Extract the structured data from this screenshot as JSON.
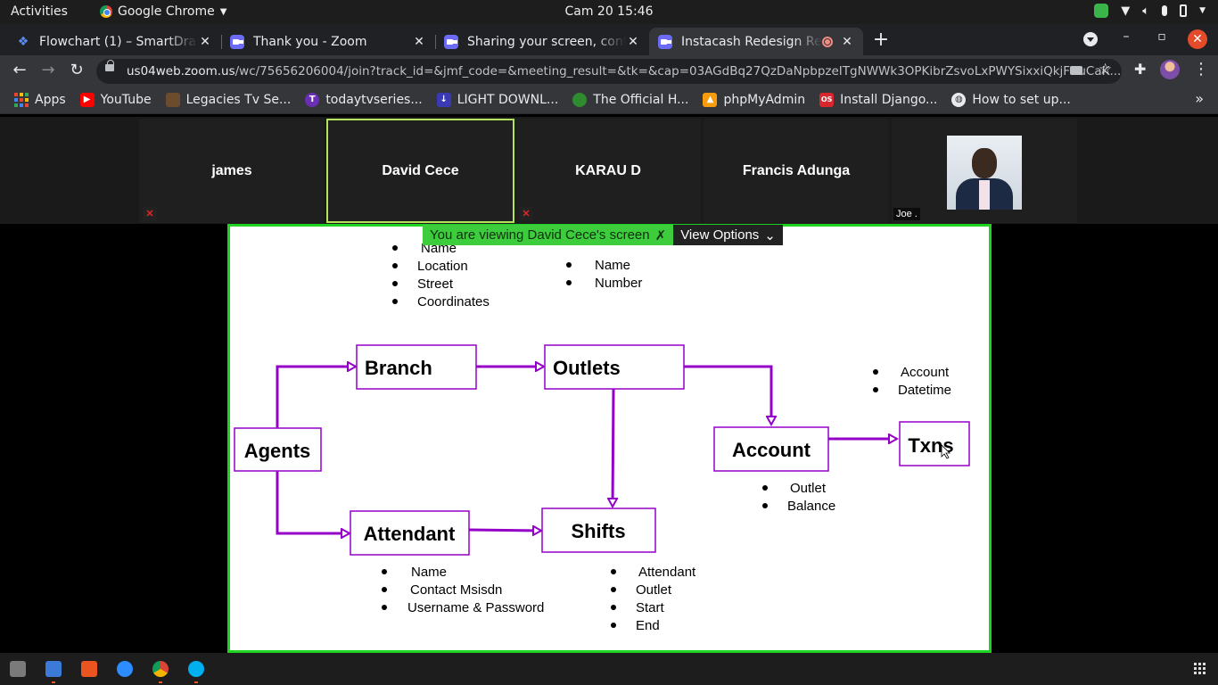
{
  "topbar": {
    "activities": "Activities",
    "app_name": "Google Chrome",
    "clock": "Cam 20  15:46"
  },
  "tabs": [
    {
      "title": "Flowchart (1) – SmartDraw",
      "favicon": "smartdraw-icon"
    },
    {
      "title": "Thank you - Zoom",
      "favicon": "zoom-icon"
    },
    {
      "title": "Sharing your screen, cont",
      "favicon": "zoom-icon"
    },
    {
      "title": "Instacash Redesign Re",
      "favicon": "zoom-icon",
      "recording": true
    }
  ],
  "omnibox": {
    "host": "us04web.zoom.us",
    "path": "/wc/75656206004/join?track_id=&jmf_code=&meeting_result=&tk=&cap=03AGdBq27QzDaNpbpzeITgNWWk3OPKibrZsvoLxPWYSixxiQkjFBuCaK..."
  },
  "bookmarks": [
    {
      "label": "Apps",
      "icon": "apps-grid-icon"
    },
    {
      "label": "YouTube",
      "icon": "youtube-icon",
      "color": "#ff0000"
    },
    {
      "label": "Legacies Tv Se...",
      "icon": "legacies-icon",
      "color": "#6b4c2f"
    },
    {
      "label": "todaytvseries...",
      "icon": "todaytv-icon",
      "color": "#6a2fb4"
    },
    {
      "label": "LIGHT DOWNL...",
      "icon": "download-icon",
      "color": "#3a3ab5"
    },
    {
      "label": "The Official H...",
      "icon": "official-icon",
      "color": "#2e8b2e"
    },
    {
      "label": "phpMyAdmin",
      "icon": "phpmyadmin-icon",
      "color": "#f89c0e"
    },
    {
      "label": "Install Django...",
      "icon": "os-icon",
      "color": "#d9262c"
    },
    {
      "label": "How to set up...",
      "icon": "globe-icon",
      "color": "#e8eaed"
    }
  ],
  "participants": [
    {
      "name": "james",
      "muted": true
    },
    {
      "name": "David Cece",
      "speaking": true,
      "muted": false
    },
    {
      "name": "KARAU D",
      "muted": true
    },
    {
      "name": "Francis Adunga",
      "muted": false
    },
    {
      "name": "Joe .",
      "video": true
    }
  ],
  "share_banner": {
    "message": "You are viewing David Cece's screen",
    "options": "View Options"
  },
  "flowchart": {
    "nodes": {
      "agents": "Agents",
      "branch": "Branch",
      "outlets": "Outlets",
      "account": "Account",
      "txns": "Txns",
      "attendant": "Attendant",
      "shifts": "Shifts"
    },
    "branch_fields": [
      "Name",
      "Location",
      "Street",
      "Coordinates"
    ],
    "outlet_fields": [
      "Name",
      "Number"
    ],
    "txn_fields": [
      "Account",
      "Datetime"
    ],
    "account_fields": [
      "Outlet",
      "Balance"
    ],
    "attendant_fields": [
      "Name",
      "Contact Msisdn",
      "Username & Password"
    ],
    "shift_fields": [
      "Attendant",
      "Outlet",
      "Start",
      "End"
    ],
    "colors": {
      "arrow": "#9400c8",
      "box": "#9400c8"
    }
  },
  "taskbar": [
    "files-icon",
    "text-editor-icon",
    "software-icon",
    "zoom-app-icon",
    "chrome-icon",
    "skype-icon"
  ]
}
